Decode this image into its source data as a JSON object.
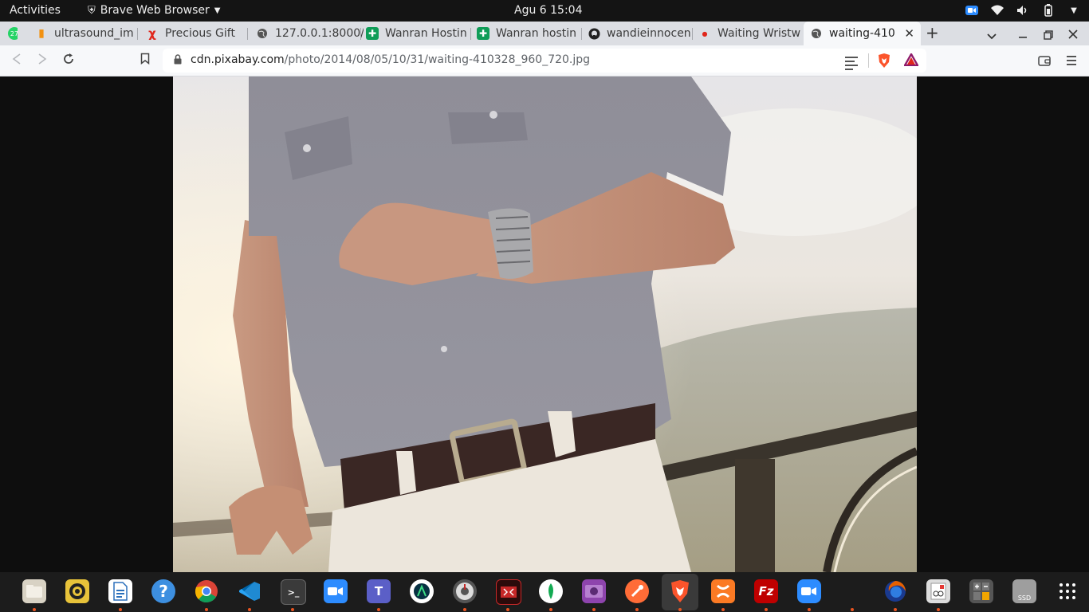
{
  "topbar": {
    "activities": "Activities",
    "app_name": "Brave Web Browser",
    "clock": "Agu 6  15:04"
  },
  "tabs": [
    {
      "title": "ultrasound_im",
      "icon": "document-icon",
      "color": "#f29111"
    },
    {
      "title": "Precious Gift",
      "icon": "figure-icon",
      "color": "#e0261b"
    },
    {
      "title": "127.0.0.1:8000/",
      "icon": "globe-icon",
      "color": "#555555"
    },
    {
      "title": "Wanran Hostin",
      "icon": "sheets-icon",
      "color": "#0f9d58"
    },
    {
      "title": "Wanran hostin",
      "icon": "sheets-icon",
      "color": "#0f9d58"
    },
    {
      "title": "wandieinnocen",
      "icon": "github-icon",
      "color": "#222222"
    },
    {
      "title": "Waiting Wristw",
      "icon": "pixabay-icon",
      "color": "#e0261b"
    },
    {
      "title": "waiting-410",
      "icon": "globe-icon",
      "color": "#555555",
      "active": true
    }
  ],
  "whatsapp_badge": "27",
  "address_bar": {
    "host": "cdn.pixabay.com",
    "path": "/photo/2014/08/05/10/31/waiting-410328_960_720.jpg"
  },
  "dock": {
    "apps": [
      {
        "name": "files",
        "color": "#d8d2c4"
      },
      {
        "name": "rhythmbox",
        "color": "#e8c33a"
      },
      {
        "name": "libreoffice-writer",
        "color": "#2a6fbb"
      },
      {
        "name": "help",
        "color": "#3d8fe0"
      },
      {
        "name": "chrome",
        "color": "#db4437"
      },
      {
        "name": "vscode",
        "color": "#1f8ad2"
      },
      {
        "name": "terminal",
        "color": "#3a3a3a"
      },
      {
        "name": "zoom",
        "color": "#2d8cff"
      },
      {
        "name": "teams",
        "color": "#5b5fc7"
      },
      {
        "name": "android-studio",
        "color": "#3ddc84"
      },
      {
        "name": "disk-tool",
        "color": "#555555"
      },
      {
        "name": "filezilla-like",
        "color": "#c62828"
      },
      {
        "name": "mongodb-compass",
        "color": "#13aa52"
      },
      {
        "name": "video-tool",
        "color": "#8e44ad"
      },
      {
        "name": "postman",
        "color": "#ff6c37"
      },
      {
        "name": "brave",
        "color": "#fb542b"
      },
      {
        "name": "xampp",
        "color": "#fb7a24"
      },
      {
        "name": "filezilla",
        "color": "#bf0000"
      },
      {
        "name": "zoom-2",
        "color": "#2d8cff"
      },
      {
        "name": "firefox",
        "color": "#e66000"
      },
      {
        "name": "document-viewer",
        "color": "#dddddd"
      },
      {
        "name": "calculator",
        "color": "#666666"
      },
      {
        "name": "ssd-drive",
        "color": "#9e9e9e"
      }
    ],
    "ssd_label": "SSD"
  }
}
